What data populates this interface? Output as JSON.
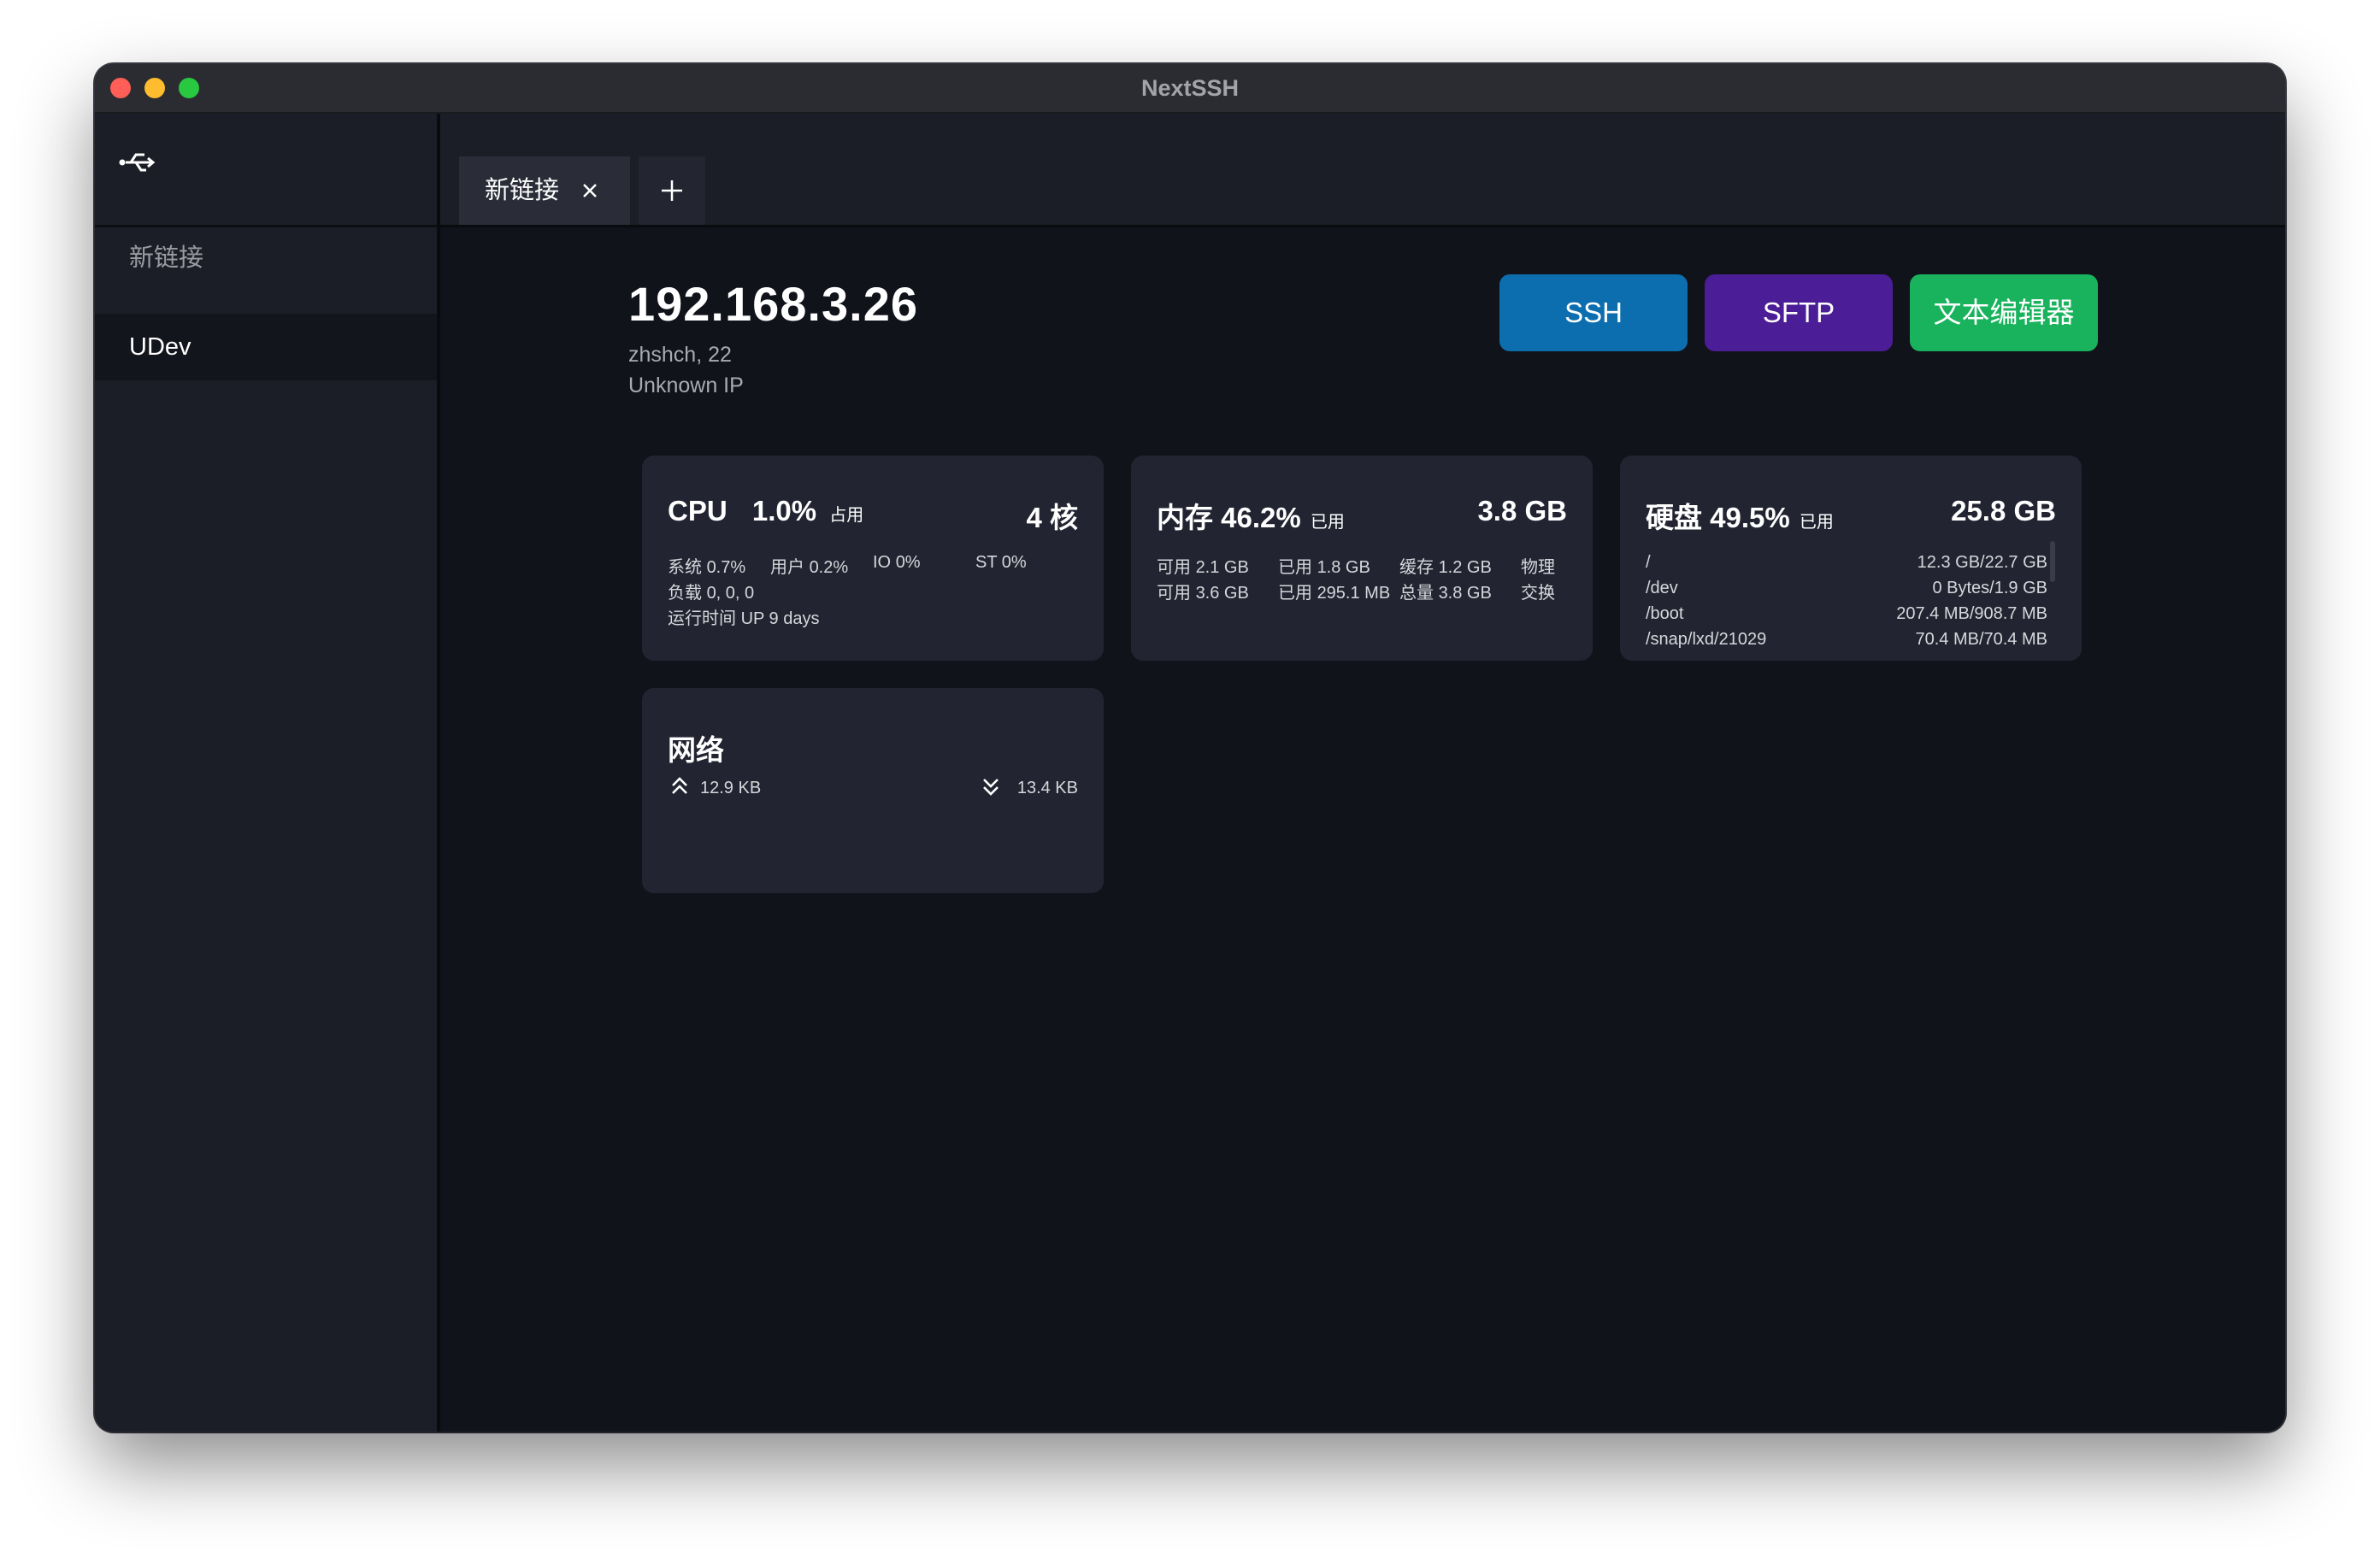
{
  "window": {
    "title": "NextSSH"
  },
  "sidebar": {
    "logo_icon": "connection-icon",
    "items": [
      {
        "label": "新链接"
      },
      {
        "label": "UDev"
      }
    ]
  },
  "tabs": [
    {
      "label": "新链接",
      "close_icon": "close-icon"
    }
  ],
  "server": {
    "host": "192.168.3.26",
    "user_port": "zhshch, 22",
    "ip_info": "Unknown IP"
  },
  "actions": {
    "ssh": "SSH",
    "sftp": "SFTP",
    "editor": "文本编辑器",
    "colors": {
      "ssh": "#0d6eaf",
      "sftp": "#4b1d96",
      "editor": "#18b35c"
    }
  },
  "cpu": {
    "title": "CPU",
    "usage": "1.0%",
    "usage_suffix": "占用",
    "cores": "4 核",
    "sys_label": "系统",
    "sys": "0.7%",
    "user_label": "用户",
    "user": "0.2%",
    "io_label": "IO",
    "io": "0%",
    "st_label": "ST",
    "st": "0%",
    "load_label": "负载",
    "load": "0, 0, 0",
    "uptime_label": "运行时间",
    "uptime": "UP 9 days"
  },
  "memory": {
    "title": "内存",
    "usage": "46.2%",
    "usage_suffix": "已用",
    "total": "3.8 GB",
    "rows": [
      {
        "avail_label": "可用",
        "avail": "2.1 GB",
        "used_label": "已用",
        "used": "1.8 GB",
        "third_label": "缓存",
        "third": "1.2 GB",
        "kind": "物理"
      },
      {
        "avail_label": "可用",
        "avail": "3.6 GB",
        "used_label": "已用",
        "used": "295.1 MB",
        "third_label": "总量",
        "third": "3.8 GB",
        "kind": "交换"
      }
    ]
  },
  "disk": {
    "title": "硬盘",
    "usage": "49.5%",
    "usage_suffix": "已用",
    "total": "25.8 GB",
    "mounts": [
      {
        "path": "/",
        "size": "12.3 GB/22.7 GB"
      },
      {
        "path": "/dev",
        "size": "0 Bytes/1.9 GB"
      },
      {
        "path": "/boot",
        "size": "207.4 MB/908.7 MB"
      },
      {
        "path": "/snap/lxd/21029",
        "size": "70.4 MB/70.4 MB"
      }
    ]
  },
  "network": {
    "title": "网络",
    "up": "12.9 KB",
    "down": "13.4 KB"
  }
}
